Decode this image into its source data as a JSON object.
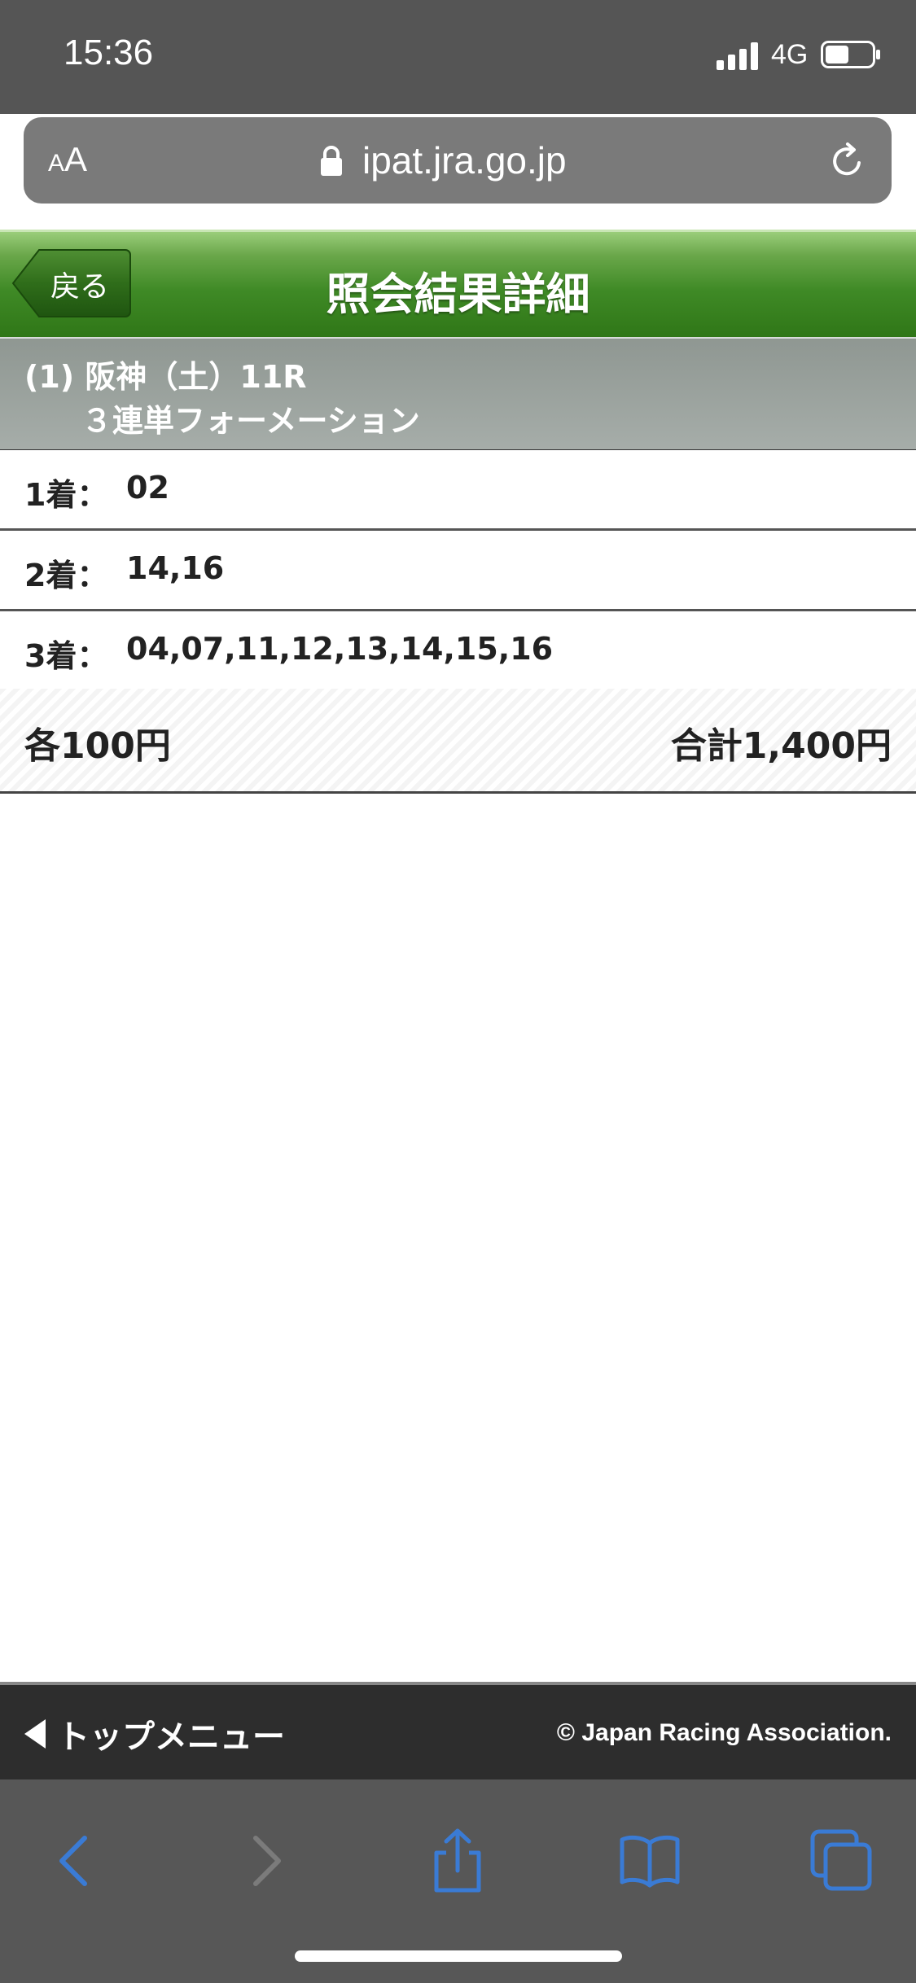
{
  "status_bar": {
    "time": "15:36",
    "network": "4G",
    "icons": [
      "signal-icon",
      "battery-icon"
    ]
  },
  "browser": {
    "text_size_small": "A",
    "text_size_large": "A",
    "url": "ipat.jra.go.jp",
    "icons": [
      "lock-icon",
      "reload-icon"
    ]
  },
  "header": {
    "back_label": "戻る",
    "title": "照会結果詳細",
    "colors": {
      "header_green": "#3f8a26"
    }
  },
  "race": {
    "line1": "(1) 阪神（土）11R",
    "line2": "３連単フォーメーション"
  },
  "results": [
    {
      "label": "1着：",
      "value": "02"
    },
    {
      "label": "2着：",
      "value": "14,16"
    },
    {
      "label": "3着：",
      "value": "04,07,11,12,13,14,15,16"
    }
  ],
  "summary": {
    "unit_price": "各100円",
    "total": "合計1,400円"
  },
  "footer": {
    "top_menu_label": "トップメニュー",
    "copyright": "© Japan Racing Association."
  },
  "toolbar": {
    "icons": [
      "back-arrow-icon",
      "forward-arrow-icon",
      "share-icon",
      "bookmarks-icon",
      "tabs-icon"
    ],
    "accent_color": "#3a7bd5"
  }
}
